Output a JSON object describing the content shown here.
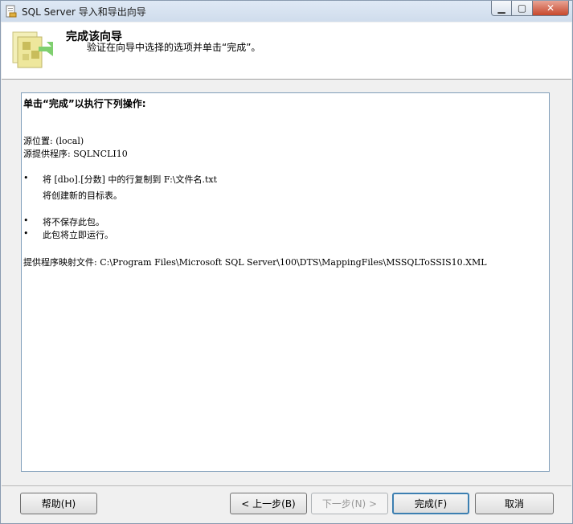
{
  "window": {
    "title": "SQL Server 导入和导出向导"
  },
  "header": {
    "title": "完成该向导",
    "subtitle": "验证在向导中选择的选项并单击“完成”。"
  },
  "content": {
    "summary_heading": "单击“完成”以执行下列操作:",
    "source_location": "源位置: (local)",
    "source_provider": "源提供程序: SQLNCLI10",
    "bullet1_line1": "将 [dbo].[分数] 中的行复制到 F:\\文件名.txt",
    "bullet1_line2": "将创建新的目标表。",
    "bullet2": "将不保存此包。",
    "bullet3": "此包将立即运行。",
    "mapping_file": "提供程序映射文件: C:\\Program Files\\Microsoft SQL Server\\100\\DTS\\MappingFiles\\MSSQLToSSIS10.XML",
    "bullet_char": "•"
  },
  "buttons": {
    "help": "帮助(H)",
    "back": "< 上一步(B)",
    "next": "下一步(N) >",
    "finish": "完成(F)",
    "cancel": "取消"
  }
}
